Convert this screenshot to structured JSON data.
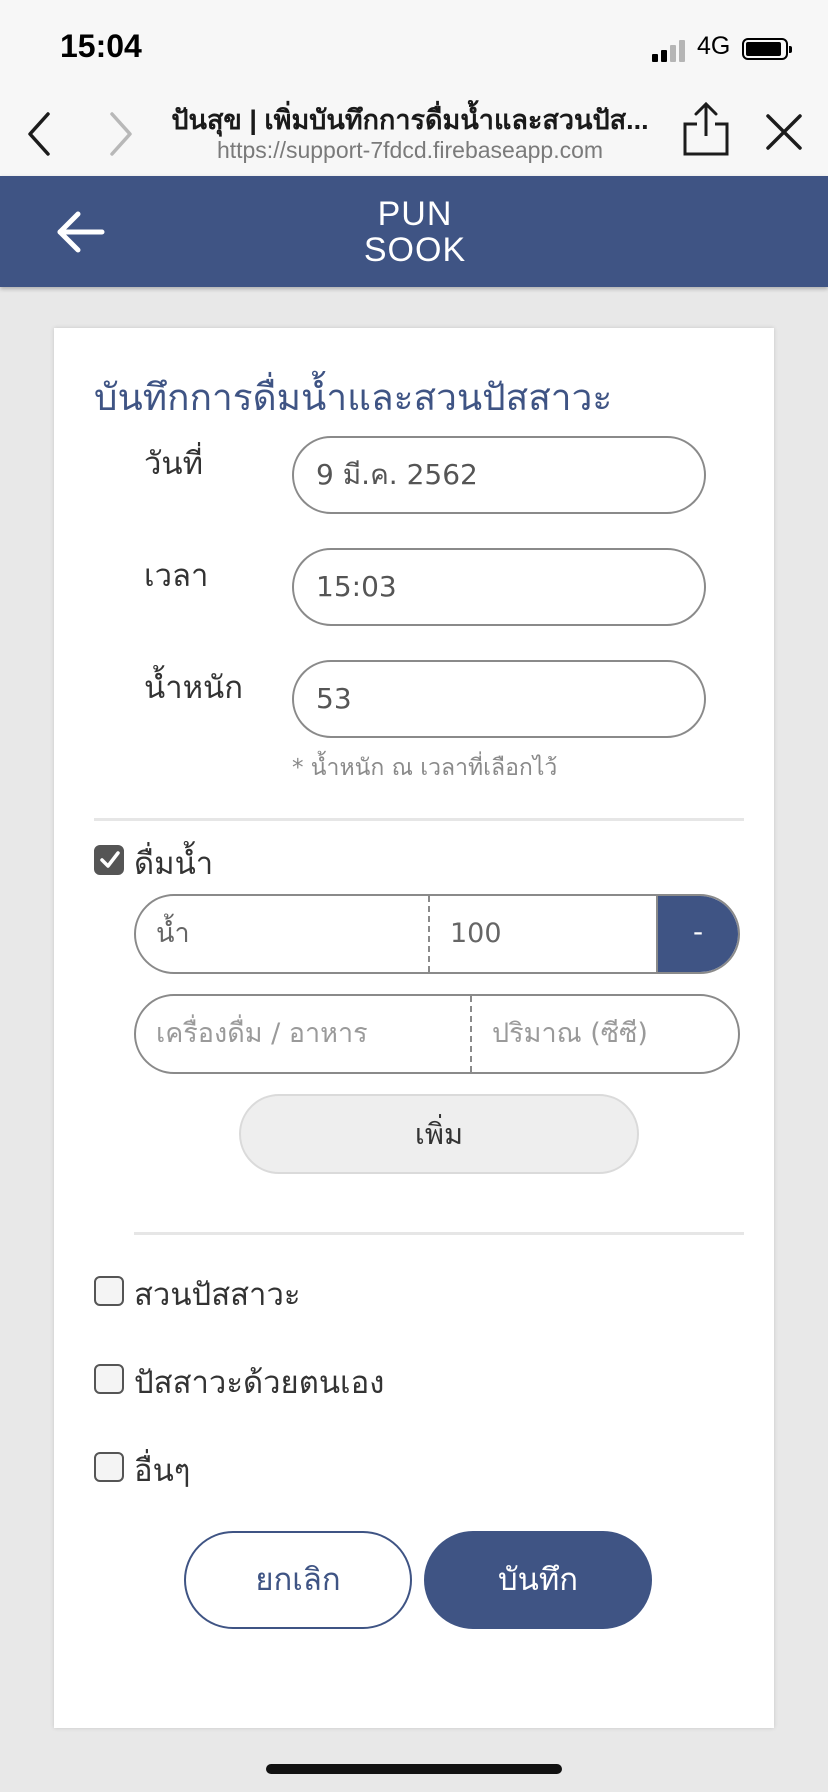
{
  "status_bar": {
    "time": "15:04",
    "network": "4G"
  },
  "browser": {
    "title": "ปันสุข | เพิ่มบันทึกการดื่มน้ำและสวนปัส...",
    "url": "https://support-7fdcd.firebaseapp.com"
  },
  "app": {
    "logo_line1": "PUN",
    "logo_line2": "SOOK",
    "brand_color": "#3f5484"
  },
  "form": {
    "title": "บันทึกการดื่มน้ำและสวนปัสสาวะ",
    "date_label": "วันที่",
    "date_value": "9 มี.ค. 2562",
    "time_label": "เวลา",
    "time_value": "15:03",
    "weight_label": "น้ำหนัก",
    "weight_value": "53",
    "weight_note": "* น้ำหนัก ณ เวลาที่เลือกไว้"
  },
  "drink": {
    "label": "ดื่มน้ำ",
    "checked": true,
    "row1_item": "น้ำ",
    "row1_amount": "100",
    "remove_label": "-",
    "item_placeholder": "เครื่องดื่ม / อาหาร",
    "amount_placeholder": "ปริมาณ (ซีซี)",
    "add_label": "เพิ่ม"
  },
  "options": [
    {
      "label": "สวนปัสสาวะ",
      "checked": false
    },
    {
      "label": "ปัสสาวะด้วยตนเอง",
      "checked": false
    },
    {
      "label": "อื่นๆ",
      "checked": false
    }
  ],
  "actions": {
    "cancel": "ยกเลิก",
    "save": "บันทึก"
  }
}
